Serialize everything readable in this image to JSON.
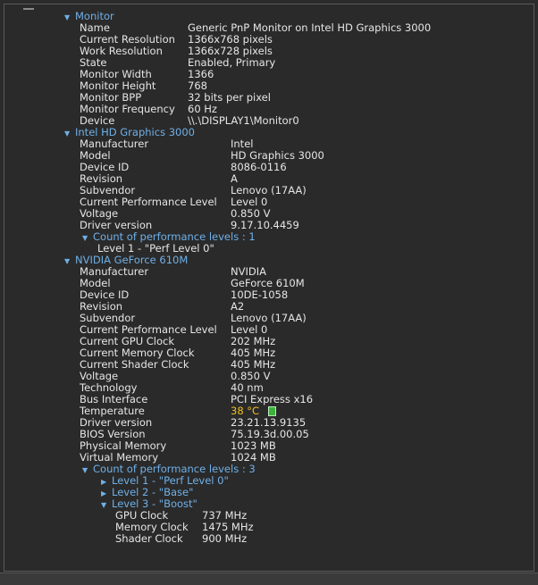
{
  "monitor": {
    "header": "Monitor",
    "props": [
      {
        "label": "Name",
        "value": "Generic PnP Monitor on Intel HD Graphics 3000"
      },
      {
        "label": "Current Resolution",
        "value": "1366x768 pixels"
      },
      {
        "label": "Work Resolution",
        "value": "1366x728 pixels"
      },
      {
        "label": "State",
        "value": "Enabled, Primary"
      },
      {
        "label": "Monitor Width",
        "value": "1366"
      },
      {
        "label": "Monitor Height",
        "value": "768"
      },
      {
        "label": "Monitor BPP",
        "value": "32 bits per pixel"
      },
      {
        "label": "Monitor Frequency",
        "value": "60 Hz"
      },
      {
        "label": "Device",
        "value": "\\\\.\\DISPLAY1\\Monitor0"
      }
    ]
  },
  "intel": {
    "header": "Intel HD Graphics 3000",
    "props": [
      {
        "label": "Manufacturer",
        "value": "Intel"
      },
      {
        "label": "Model",
        "value": "HD Graphics 3000"
      },
      {
        "label": "Device ID",
        "value": "8086-0116"
      },
      {
        "label": "Revision",
        "value": "A"
      },
      {
        "label": "Subvendor",
        "value": "Lenovo (17AA)"
      },
      {
        "label": "Current Performance Level",
        "value": "Level 0"
      },
      {
        "label": "Voltage",
        "value": "0.850 V"
      },
      {
        "label": "Driver version",
        "value": "9.17.10.4459"
      }
    ],
    "perf_header": "Count of performance levels : 1",
    "perf_levels": [
      "Level 1 - \"Perf Level 0\""
    ]
  },
  "nvidia": {
    "header": "NVIDIA GeForce 610M",
    "props": [
      {
        "label": "Manufacturer",
        "value": "NVIDIA"
      },
      {
        "label": "Model",
        "value": "GeForce 610M"
      },
      {
        "label": "Device ID",
        "value": "10DE-1058"
      },
      {
        "label": "Revision",
        "value": "A2"
      },
      {
        "label": "Subvendor",
        "value": "Lenovo (17AA)"
      },
      {
        "label": "Current Performance Level",
        "value": "Level 0"
      },
      {
        "label": "Current GPU Clock",
        "value": "202 MHz"
      },
      {
        "label": "Current Memory Clock",
        "value": "405 MHz"
      },
      {
        "label": "Current Shader Clock",
        "value": "405 MHz"
      },
      {
        "label": "Voltage",
        "value": "0.850 V"
      },
      {
        "label": "Technology",
        "value": "40 nm"
      },
      {
        "label": "Bus Interface",
        "value": "PCI Express x16"
      },
      {
        "label": "Temperature",
        "value": "38 °C"
      },
      {
        "label": "Driver version",
        "value": "23.21.13.9135"
      },
      {
        "label": "BIOS Version",
        "value": "75.19.3d.00.05"
      },
      {
        "label": "Physical Memory",
        "value": "1023 MB"
      },
      {
        "label": "Virtual Memory",
        "value": "1024 MB"
      }
    ],
    "perf_header": "Count of performance levels : 3",
    "perf_levels": [
      {
        "label": "Level 1 - \"Perf Level 0\"",
        "expanded": false
      },
      {
        "label": "Level 2 - \"Base\"",
        "expanded": false
      },
      {
        "label": "Level 3 - \"Boost\"",
        "expanded": true
      }
    ],
    "boost_props": [
      {
        "label": "GPU Clock",
        "value": "737 MHz"
      },
      {
        "label": "Memory Clock",
        "value": "1475 MHz"
      },
      {
        "label": "Shader Clock",
        "value": "900 MHz"
      }
    ]
  },
  "colors": {
    "header": "#6fb0e8",
    "temperature": "#f0c020",
    "background": "#2a2a2a"
  },
  "icons": {
    "expanded": "triangle-down-icon",
    "collapsed": "triangle-right-icon",
    "temperature": "thermometer-icon"
  }
}
